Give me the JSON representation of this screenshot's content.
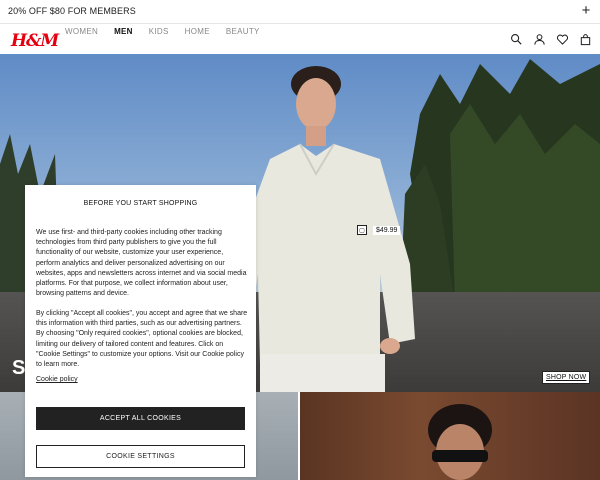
{
  "promo": {
    "text": "20% OFF $80 FOR MEMBERS",
    "expand_icon": "plus-icon"
  },
  "header": {
    "logo": "H&M",
    "nav": [
      {
        "label": "WOMEN",
        "active": false
      },
      {
        "label": "MEN",
        "active": true
      },
      {
        "label": "KIDS",
        "active": false
      },
      {
        "label": "HOME",
        "active": false
      },
      {
        "label": "BEAUTY",
        "active": false
      }
    ],
    "icons": [
      "search-icon",
      "account-icon",
      "favorites-icon",
      "bag-icon"
    ]
  },
  "hero": {
    "price": "$49.99",
    "headline_fragment": "S",
    "cta": "SHOP NOW"
  },
  "cookie": {
    "title": "BEFORE YOU START SHOPPING",
    "paragraph1": "We use first- and third-party cookies including other tracking technologies from third party publishers to give you the full functionality of our website, customize your user experience, perform analytics and deliver personalized advertising on our websites, apps and newsletters across internet and via social media platforms. For that purpose, we collect information about user, browsing patterns and device.",
    "paragraph2": "By clicking \"Accept all cookies\", you accept and agree that we share this information with third parties, such as our advertising partners. By choosing \"Only required cookies\", optional cookies are blocked, limiting our delivery of tailored content and features. Click on \"Cookie Settings\" to customize your options. Visit our Cookie policy to learn more.",
    "policy_link": "Cookie policy",
    "accept_label": "ACCEPT ALL COOKIES",
    "settings_label": "COOKIE SETTINGS"
  },
  "colors": {
    "brand_red": "#e50010",
    "button_dark": "#222222"
  }
}
